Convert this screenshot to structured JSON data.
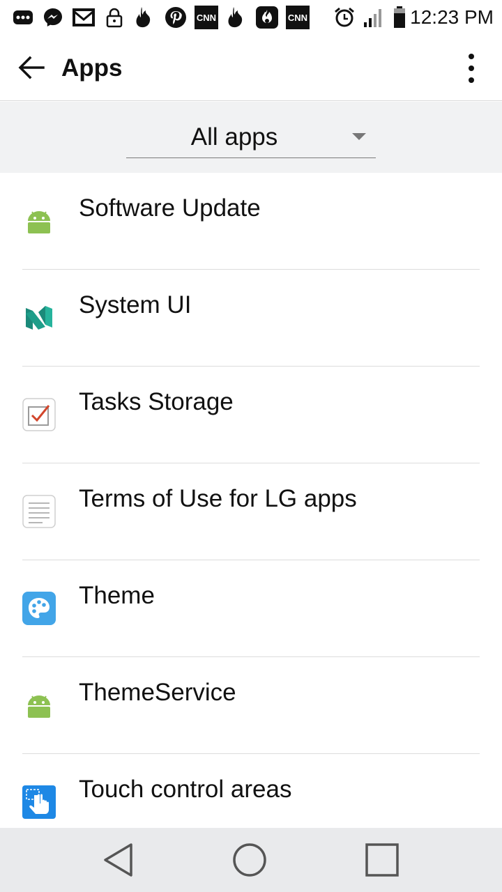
{
  "status_bar": {
    "time": "12:23 PM",
    "notification_icons": [
      "more-notifications-icon",
      "messenger-icon",
      "gmail-icon",
      "lock-icon",
      "tinder-icon",
      "pinterest-icon",
      "cnn-icon",
      "tinder-icon",
      "hotspot-icon",
      "cnn-icon"
    ],
    "cnn_text": "CNN"
  },
  "app_bar": {
    "title": "Apps",
    "back_icon": "arrow-back-icon",
    "menu_icon": "overflow-menu-icon"
  },
  "filter": {
    "selected": "All apps"
  },
  "apps": [
    {
      "label": "Software Update",
      "icon": "android-icon",
      "color": "#8dc152"
    },
    {
      "label": "System UI",
      "icon": "android-n-icon",
      "color": "#1b8a7a"
    },
    {
      "label": "Tasks Storage",
      "icon": "tasks-checkbox-icon",
      "color": "#d2452b"
    },
    {
      "label": "Terms of Use for LG apps",
      "icon": "document-icon",
      "color": "#9e9e9e"
    },
    {
      "label": "Theme",
      "icon": "palette-icon",
      "color": "#42a5e8"
    },
    {
      "label": "ThemeService",
      "icon": "android-icon",
      "color": "#8dc152"
    },
    {
      "label": "Touch control areas",
      "icon": "touch-hand-icon",
      "color": "#1e88e5"
    }
  ],
  "nav_bar": {
    "back": "nav-back-icon",
    "home": "nav-home-icon",
    "recents": "nav-recents-icon"
  }
}
